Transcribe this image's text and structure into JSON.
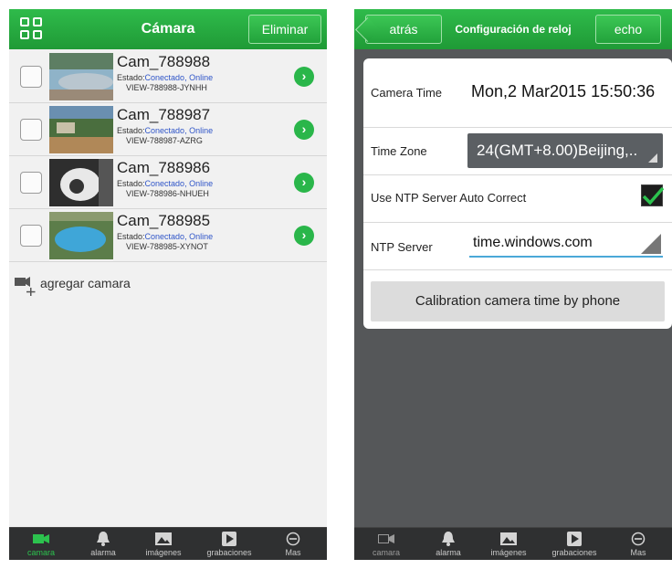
{
  "left_screen": {
    "header": {
      "title": "Cámara",
      "delete_label": "Eliminar"
    },
    "cameras": [
      {
        "name": "Cam_788988",
        "status_prefix": "Estado:",
        "status": "Conectado, Online",
        "uid": "VIEW-788988-JYNHH",
        "thumb": "thumb-pool-cover"
      },
      {
        "name": "Cam_788987",
        "status_prefix": "Estado:",
        "status": "Conectado, Online",
        "uid": "VIEW-788987-AZRG",
        "thumb": "thumb-backyard"
      },
      {
        "name": "Cam_788986",
        "status_prefix": "Estado:",
        "status": "Conectado, Online",
        "uid": "VIEW-788986-NHUEH",
        "thumb": "thumb-indoor-camera"
      },
      {
        "name": "Cam_788985",
        "status_prefix": "Estado:",
        "status": "Conectado, Online",
        "uid": "VIEW-788985-XYNOT",
        "thumb": "thumb-pool"
      }
    ],
    "add_camera_label": "agregar camara"
  },
  "right_screen": {
    "header": {
      "back_label": "atrás",
      "title": "Configuración de reloj",
      "done_label": "echo"
    },
    "camera_time": {
      "label": "Camera Time",
      "value": "Mon,2 Mar2015 15:50:36"
    },
    "time_zone": {
      "label": "Time Zone",
      "value": "24(GMT+8.00)Beijing,.."
    },
    "ntp_auto": {
      "label": "Use NTP Server Auto Correct",
      "checked": true
    },
    "ntp_server": {
      "label": "NTP Server",
      "value": "time.windows.com"
    },
    "calibrate_label": "Calibration camera time by phone"
  },
  "tabbar": {
    "tabs": [
      {
        "label": "camara",
        "icon": "video-camera-icon"
      },
      {
        "label": "alarma",
        "icon": "bell-icon"
      },
      {
        "label": "imágenes",
        "icon": "image-icon"
      },
      {
        "label": "grabaciones",
        "icon": "play-icon"
      },
      {
        "label": "Mas",
        "icon": "more-icon"
      }
    ]
  },
  "colors": {
    "brand_green": "#2ab64a",
    "online_blue": "#2f55c8",
    "tab_bg": "#2f3031"
  }
}
